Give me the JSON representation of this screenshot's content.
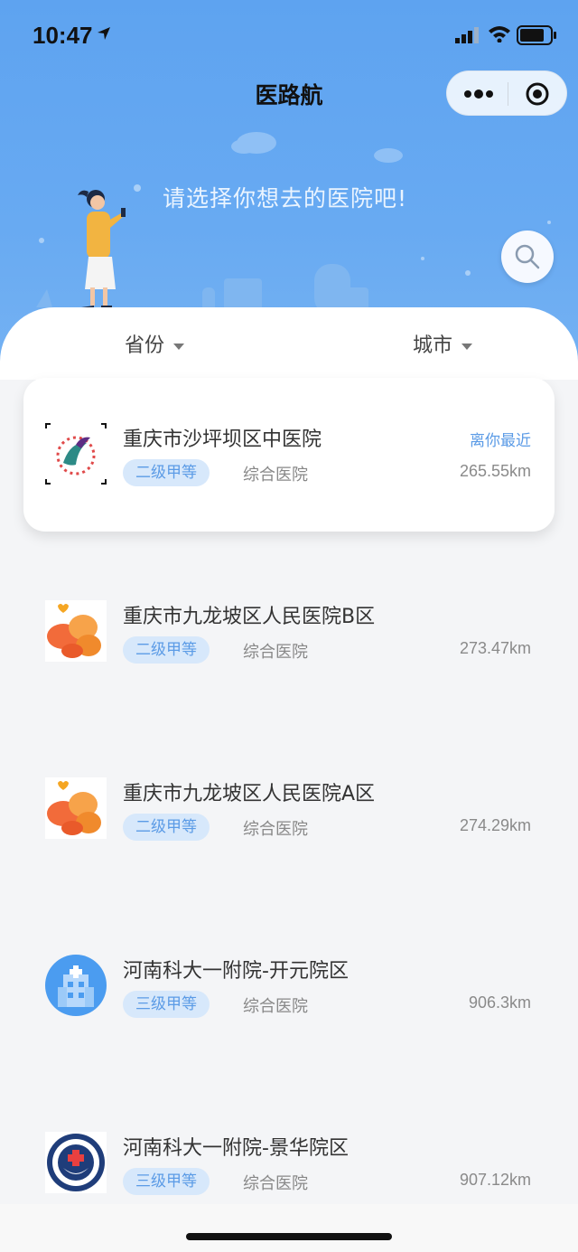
{
  "status": {
    "time": "10:47",
    "icons": [
      "location-arrow-icon",
      "signal-icon",
      "wifi-icon",
      "battery-icon"
    ]
  },
  "nav": {
    "title": "医路航",
    "capsule_icons": [
      "more-icon",
      "close-target-icon"
    ]
  },
  "hero": {
    "slogan": "请选择你想去的医院吧!",
    "search_icon": "search-icon"
  },
  "filters": {
    "province": "省份",
    "city": "城市"
  },
  "hospitals": [
    {
      "name": "重庆市沙坪坝区中医院",
      "level": "二级甲等",
      "type": "综合医院",
      "distance": "265.55km",
      "badge": "离你最近",
      "logo": "tcm-logo"
    },
    {
      "name": "重庆市九龙坡区人民医院B区",
      "level": "二级甲等",
      "type": "综合医院",
      "distance": "273.47km",
      "badge": "",
      "logo": "orange-flower-logo"
    },
    {
      "name": "重庆市九龙坡区人民医院A区",
      "level": "二级甲等",
      "type": "综合医院",
      "distance": "274.29km",
      "badge": "",
      "logo": "orange-flower-logo"
    },
    {
      "name": "河南科大一附院-开元院区",
      "level": "三级甲等",
      "type": "综合医院",
      "distance": "906.3km",
      "badge": "",
      "logo": "hospital-building-logo"
    },
    {
      "name": "河南科大一附院-景华院区",
      "level": "三级甲等",
      "type": "综合医院",
      "distance": "907.12km",
      "badge": "",
      "logo": "emblem-logo"
    }
  ],
  "colors": {
    "header_blue": "#5ea3f0",
    "accent_blue": "#5b9be6",
    "tag_bg": "#d7e8fb"
  }
}
